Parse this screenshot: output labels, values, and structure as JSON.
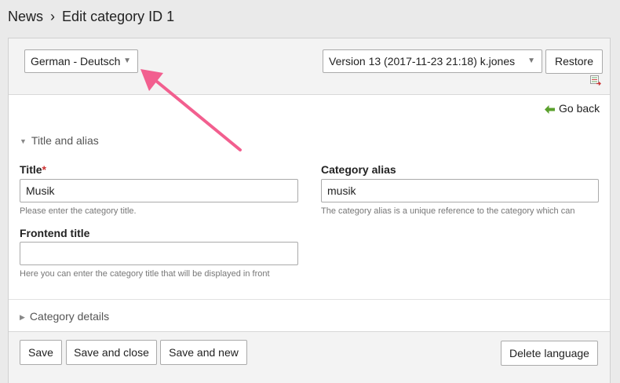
{
  "header": {
    "breadcrumb_root": "News",
    "separator": "›",
    "title": "Edit category ID 1"
  },
  "toolbar": {
    "language_select": {
      "value": "German - Deutsch",
      "caret": "▼"
    },
    "version_select": {
      "value": "Version 13 (2017-11-23 21:18) k.jones",
      "caret": "▼"
    },
    "restore_label": "Restore",
    "diff_icon": "diff-icon"
  },
  "go_back": {
    "label": "Go back",
    "icon": "back-arrow-icon"
  },
  "sections": {
    "title_alias": {
      "legend": "Title and alias",
      "icon": "triangle-down-icon"
    },
    "category_details": {
      "legend": "Category details",
      "icon": "triangle-right-icon"
    }
  },
  "fields": {
    "title": {
      "label": "Title",
      "required_marker": "*",
      "value": "Musik",
      "help": "Please enter the category title."
    },
    "alias": {
      "label": "Category alias",
      "value": "musik",
      "help": "The category alias is a unique reference to the category which can"
    },
    "frontend_title": {
      "label": "Frontend title",
      "value": "",
      "help": "Here you can enter the category title that will be displayed in front"
    }
  },
  "footer": {
    "save": "Save",
    "save_close": "Save and close",
    "save_new": "Save and new",
    "delete_language": "Delete language"
  },
  "colors": {
    "annotation_arrow": "#f25f8f",
    "back_arrow": "#5aa02c",
    "required": "#cc3333"
  }
}
